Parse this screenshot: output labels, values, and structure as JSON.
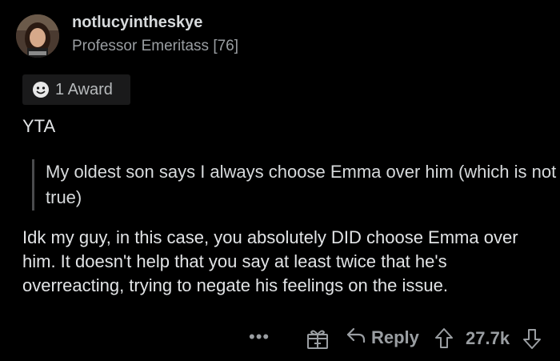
{
  "comment": {
    "username": "notlucyintheskye",
    "flair": "Professor Emeritass [76]",
    "award_label": "1 Award",
    "verdict": "YTA",
    "quote": "My oldest son says I always choose Emma over him (which is not true)",
    "body": "Idk my guy, in this case, you absolutely DID choose Emma over him.  It doesn't help that you say at least twice that he's overreacting, trying to negate his feelings on the issue."
  },
  "actions": {
    "more_label": "•••",
    "reply_label": "Reply",
    "score": "27.7k"
  },
  "icons": {
    "award": "award-icon",
    "gift": "gift-award-icon",
    "reply": "reply-arrow-icon",
    "upvote": "upvote-arrow-icon",
    "downvote": "downvote-arrow-icon"
  },
  "colors": {
    "background": "#000000",
    "text": "#d7dadc",
    "muted": "#9a9ea2",
    "award_pill": "#1a1a1b"
  }
}
